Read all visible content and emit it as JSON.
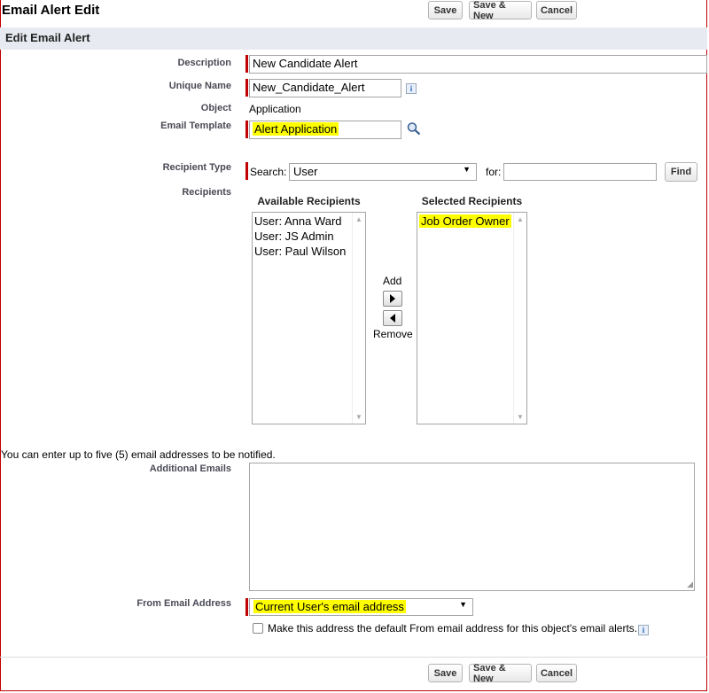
{
  "page": {
    "title": "Email Alert Edit"
  },
  "toolbar": {
    "save": "Save",
    "save_new": "Save & New",
    "cancel": "Cancel"
  },
  "section": {
    "title": "Edit Email Alert"
  },
  "form": {
    "description": {
      "label": "Description",
      "value": "New Candidate Alert"
    },
    "unique_name": {
      "label": "Unique Name",
      "value": "New_Candidate_Alert",
      "info": "i"
    },
    "object": {
      "label": "Object",
      "value": "Application"
    },
    "email_template": {
      "label": "Email Template",
      "value": "Alert Application",
      "lookup_icon": "magnifier-icon"
    },
    "recipient_type": {
      "label": "Recipient Type",
      "search_label": "Search:",
      "search_selected": "User",
      "for_label": "for:",
      "for_value": "",
      "find_button": "Find"
    },
    "recipients": {
      "label": "Recipients",
      "available_header": "Available Recipients",
      "available": [
        "User: Anna Ward",
        "User: JS Admin",
        "User: Paul Wilson"
      ],
      "add_label": "Add",
      "remove_label": "Remove",
      "selected_header": "Selected Recipients",
      "selected": [
        "Job Order Owner"
      ]
    },
    "emails_note": "You can enter up to five (5) email addresses to be notified.",
    "additional_emails": {
      "label": "Additional Emails",
      "value": ""
    },
    "from_email": {
      "label": "From Email Address",
      "selected": "Current User's email address",
      "default_checkbox_label": "Make this address the default From email address for this object's email alerts.",
      "default_checked": false,
      "info": "i"
    }
  },
  "colors": {
    "required_bar": "#c00000",
    "highlight": "#ffff00",
    "section_bg": "#e7eaf0"
  }
}
